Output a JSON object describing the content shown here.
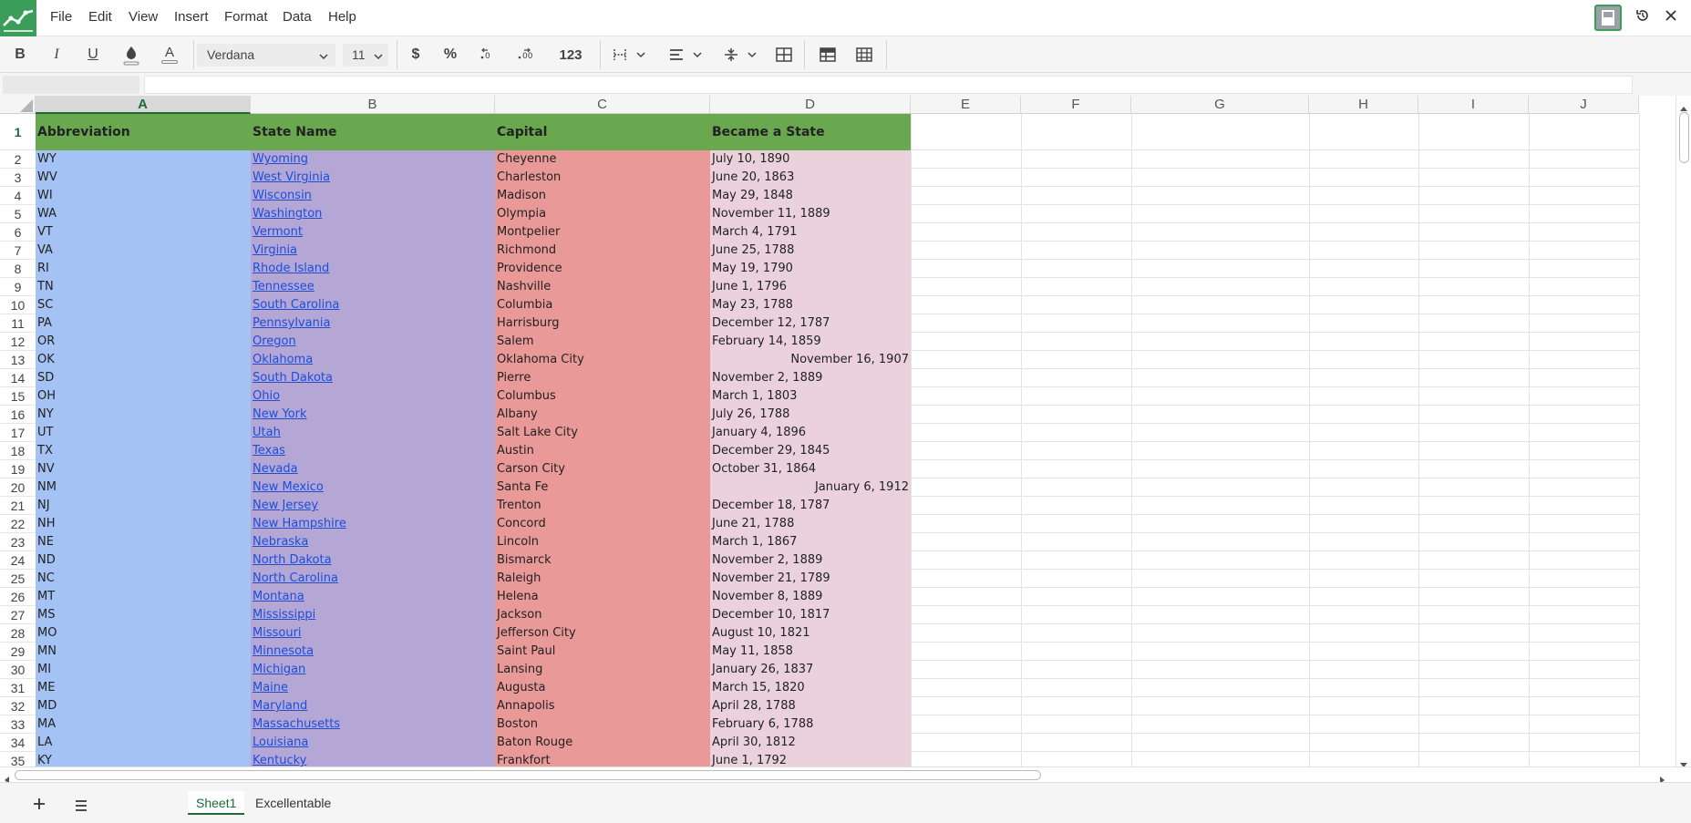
{
  "menubar": {
    "items": [
      "File",
      "Edit",
      "View",
      "Insert",
      "Format",
      "Data",
      "Help"
    ]
  },
  "toolbar": {
    "font_family": "Verdana",
    "font_size": "11",
    "currency_label": "$",
    "percent_label": "%",
    "number_format_label": "123",
    "bold_label": "B",
    "italic_label": "I",
    "underline_label": "U",
    "text_color_label": "A"
  },
  "columns": [
    "A",
    "B",
    "C",
    "D",
    "E",
    "F",
    "G",
    "H",
    "I",
    "J"
  ],
  "header_row": [
    "Abbreviation",
    "State Name",
    "Capital",
    "Became a State"
  ],
  "rows": [
    [
      "WY",
      "Wyoming",
      "Cheyenne",
      "July 10, 1890"
    ],
    [
      "WV",
      "West Virginia",
      "Charleston",
      "June 20, 1863"
    ],
    [
      "WI",
      "Wisconsin",
      "Madison",
      "May 29, 1848"
    ],
    [
      "WA",
      "Washington",
      "Olympia",
      "November 11, 1889"
    ],
    [
      "VT",
      "Vermont",
      "Montpelier",
      "March 4, 1791"
    ],
    [
      "VA",
      "Virginia",
      "Richmond",
      "June 25, 1788"
    ],
    [
      "RI",
      "Rhode Island",
      "Providence",
      "May 19, 1790"
    ],
    [
      "TN",
      "Tennessee",
      "Nashville",
      "June 1, 1796"
    ],
    [
      "SC",
      "South Carolina",
      "Columbia",
      "May 23, 1788"
    ],
    [
      "PA",
      "Pennsylvania",
      "Harrisburg",
      "December 12, 1787"
    ],
    [
      "OR",
      "Oregon",
      "Salem",
      "February 14, 1859"
    ],
    [
      "OK",
      "Oklahoma",
      "Oklahoma City",
      "November 16, 1907"
    ],
    [
      "SD",
      "South Dakota",
      "Pierre",
      "November 2, 1889"
    ],
    [
      "OH",
      "Ohio",
      "Columbus",
      "March 1, 1803"
    ],
    [
      "NY",
      "New York",
      "Albany",
      "July 26, 1788"
    ],
    [
      "UT",
      "Utah",
      "Salt Lake City",
      "January 4, 1896"
    ],
    [
      "TX",
      "Texas",
      "Austin",
      "December 29, 1845"
    ],
    [
      "NV",
      "Nevada",
      "Carson City",
      "October 31, 1864"
    ],
    [
      "NM",
      "New Mexico",
      "Santa Fe",
      "January 6, 1912"
    ],
    [
      "NJ",
      "New Jersey",
      "Trenton",
      "December 18, 1787"
    ],
    [
      "NH",
      "New Hampshire",
      "Concord",
      "June 21, 1788"
    ],
    [
      "NE",
      "Nebraska",
      "Lincoln",
      "March 1, 1867"
    ],
    [
      "ND",
      "North Dakota",
      "Bismarck",
      "November 2, 1889"
    ],
    [
      "NC",
      "North Carolina",
      "Raleigh",
      "November 21, 1789"
    ],
    [
      "MT",
      "Montana",
      "Helena",
      "November 8, 1889"
    ],
    [
      "MS",
      "Mississippi",
      "Jackson",
      "December 10, 1817"
    ],
    [
      "MO",
      "Missouri",
      "Jefferson City",
      "August 10, 1821"
    ],
    [
      "MN",
      "Minnesota",
      "Saint Paul",
      "May 11, 1858"
    ],
    [
      "MI",
      "Michigan",
      "Lansing",
      "January 26, 1837"
    ],
    [
      "ME",
      "Maine",
      "Augusta",
      "March 15, 1820"
    ],
    [
      "MD",
      "Maryland",
      "Annapolis",
      "April 28, 1788"
    ],
    [
      "MA",
      "Massachusetts",
      "Boston",
      "February 6, 1788"
    ],
    [
      "LA",
      "Louisiana",
      "Baton Rouge",
      "April 30, 1812"
    ],
    [
      "KY",
      "Kentucky",
      "Frankfort",
      "June 1, 1792"
    ]
  ],
  "right_aligned_dates": [
    "November 16, 1907",
    "January 6, 1912"
  ],
  "sheets": [
    "Sheet1",
    "Excellentable"
  ],
  "active_sheet": "Sheet1",
  "colors": {
    "header_green": "#6aa84f",
    "col_a": "#a4c2f4",
    "col_b": "#b4a7d6",
    "col_c": "#ea9999",
    "col_d": "#ead1dc",
    "accent": "#1f6a36"
  }
}
